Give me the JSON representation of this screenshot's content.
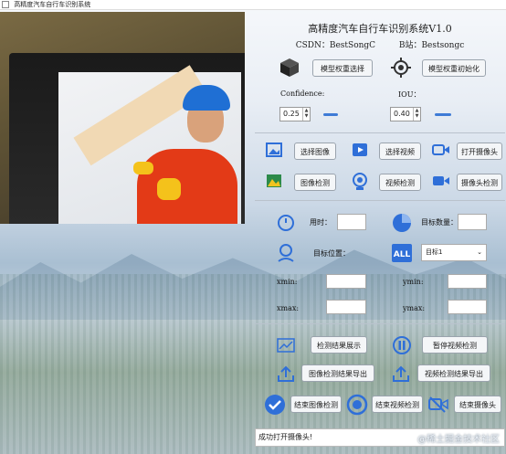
{
  "window": {
    "title": "高精度汽车自行车识别系统"
  },
  "header": {
    "title": "高精度汽车自行车识别系统V1.0",
    "csdn": "CSDN：BestSongC",
    "bilibili": "B站：Bestsongc"
  },
  "model": {
    "select_label": "模型权重选择",
    "init_label": "模型权重初始化"
  },
  "params": {
    "confidence_label": "Confidence:",
    "confidence_value": "0.25",
    "iou_label": "IOU：",
    "iou_value": "0.40"
  },
  "actions": {
    "select_image": "选择图像",
    "select_video": "选择视频",
    "open_camera": "打开摄像头",
    "image_detect": "图像检测",
    "video_detect": "视频检测",
    "camera_detect": "摄像头检测"
  },
  "results": {
    "time_label": "用时：",
    "count_label": "目标数量：",
    "position_label": "目标位置：",
    "target_select": "目标1",
    "xmin_label": "xmin:",
    "ymin_label": "ymin:",
    "xmax_label": "xmax:",
    "ymax_label": "ymax:"
  },
  "bottom": {
    "show_results": "检测结果展示",
    "pause_video": "暂停视频检测",
    "export_image": "图像检测结果导出",
    "export_video": "视频检测结果导出",
    "end_image": "结束图像检测",
    "end_video": "结束视频检测",
    "end_camera": "结束摄像头"
  },
  "status": {
    "message": "成功打开摄像头!"
  },
  "watermark": "@稀土掘金技术社区",
  "colors": {
    "accent": "#3e7bd6",
    "icon_blue": "#2f6fd8"
  }
}
